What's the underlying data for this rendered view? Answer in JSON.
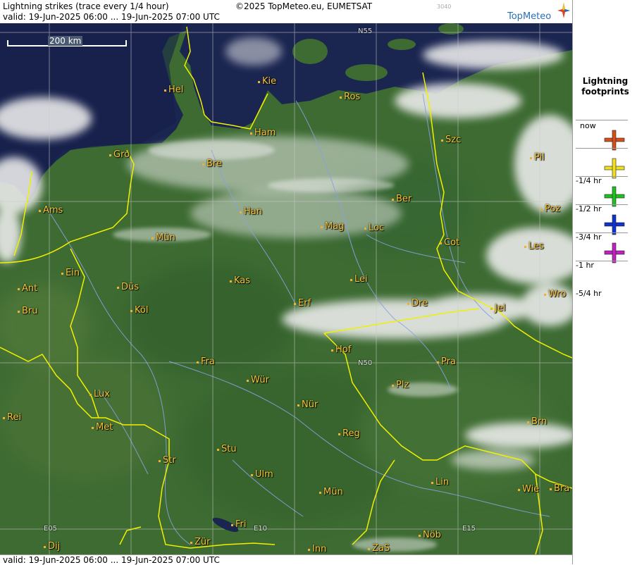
{
  "header": {
    "title": "Lightning strikes (trace every 1/4 hour)",
    "valid": "valid:  19-Jun-2025 06:00 ... 19-Jun-2025 07:00 UTC",
    "copyright": "©2025 TopMeteo.eu, EUMETSAT",
    "code": "3040",
    "brand": "TopMeteo"
  },
  "footer": {
    "valid": "valid:  19-Jun-2025 06:00 ... 19-Jun-2025 07:00 UTC"
  },
  "scale": {
    "label": "200 km"
  },
  "grid_labels": {
    "n55": "N55",
    "n50": "N50",
    "e05": "E05",
    "e10": "E10",
    "e15": "E15"
  },
  "cities": [
    {
      "name": "Kie"
    },
    {
      "name": "Hel"
    },
    {
      "name": "Ros"
    },
    {
      "name": "Ham"
    },
    {
      "name": "Szc"
    },
    {
      "name": "Gro"
    },
    {
      "name": "Bre"
    },
    {
      "name": "Pil"
    },
    {
      "name": "Ber"
    },
    {
      "name": "Ams"
    },
    {
      "name": "Han"
    },
    {
      "name": "Poz"
    },
    {
      "name": "Mag"
    },
    {
      "name": "Loc"
    },
    {
      "name": "Mün"
    },
    {
      "name": "Cot"
    },
    {
      "name": "Les"
    },
    {
      "name": "Ein"
    },
    {
      "name": "Kas"
    },
    {
      "name": "Lei"
    },
    {
      "name": "Ant"
    },
    {
      "name": "Düs"
    },
    {
      "name": "Wro"
    },
    {
      "name": "Dre"
    },
    {
      "name": "Bru"
    },
    {
      "name": "Köl"
    },
    {
      "name": "Erf"
    },
    {
      "name": "Jel"
    },
    {
      "name": "Hof"
    },
    {
      "name": "Fra"
    },
    {
      "name": "Pra"
    },
    {
      "name": "Wür"
    },
    {
      "name": "Lux"
    },
    {
      "name": "Plz"
    },
    {
      "name": "Rei"
    },
    {
      "name": "Nür"
    },
    {
      "name": "Met"
    },
    {
      "name": "Reg"
    },
    {
      "name": "Brn"
    },
    {
      "name": "Stu"
    },
    {
      "name": "Str"
    },
    {
      "name": "Ulm"
    },
    {
      "name": "Lin"
    },
    {
      "name": "Wie"
    },
    {
      "name": "Bra"
    },
    {
      "name": "Mün"
    },
    {
      "name": "Fri"
    },
    {
      "name": "Dij"
    },
    {
      "name": "Zür"
    },
    {
      "name": "Inn"
    },
    {
      "name": "ZaS"
    },
    {
      "name": "Nöb"
    }
  ],
  "legend": {
    "title_line1": "Lightning",
    "title_line2": "footprints",
    "levels": [
      {
        "label": "now",
        "color": "#d4501a"
      },
      {
        "label": "-1/4 hr",
        "color": "#f0e020"
      },
      {
        "label": "-1/2 hr",
        "color": "#20c020"
      },
      {
        "label": "-3/4 hr",
        "color": "#1030d0"
      },
      {
        "label": "-1 hr",
        "color": "#c020c0"
      },
      {
        "label": "-5/4 hr",
        "color": ""
      }
    ]
  },
  "colors": {
    "land": "#3d6b32",
    "sea": "#1a2550",
    "border": "#f0f000",
    "river": "#8aa0e0",
    "cloud": "#eeeeee"
  }
}
